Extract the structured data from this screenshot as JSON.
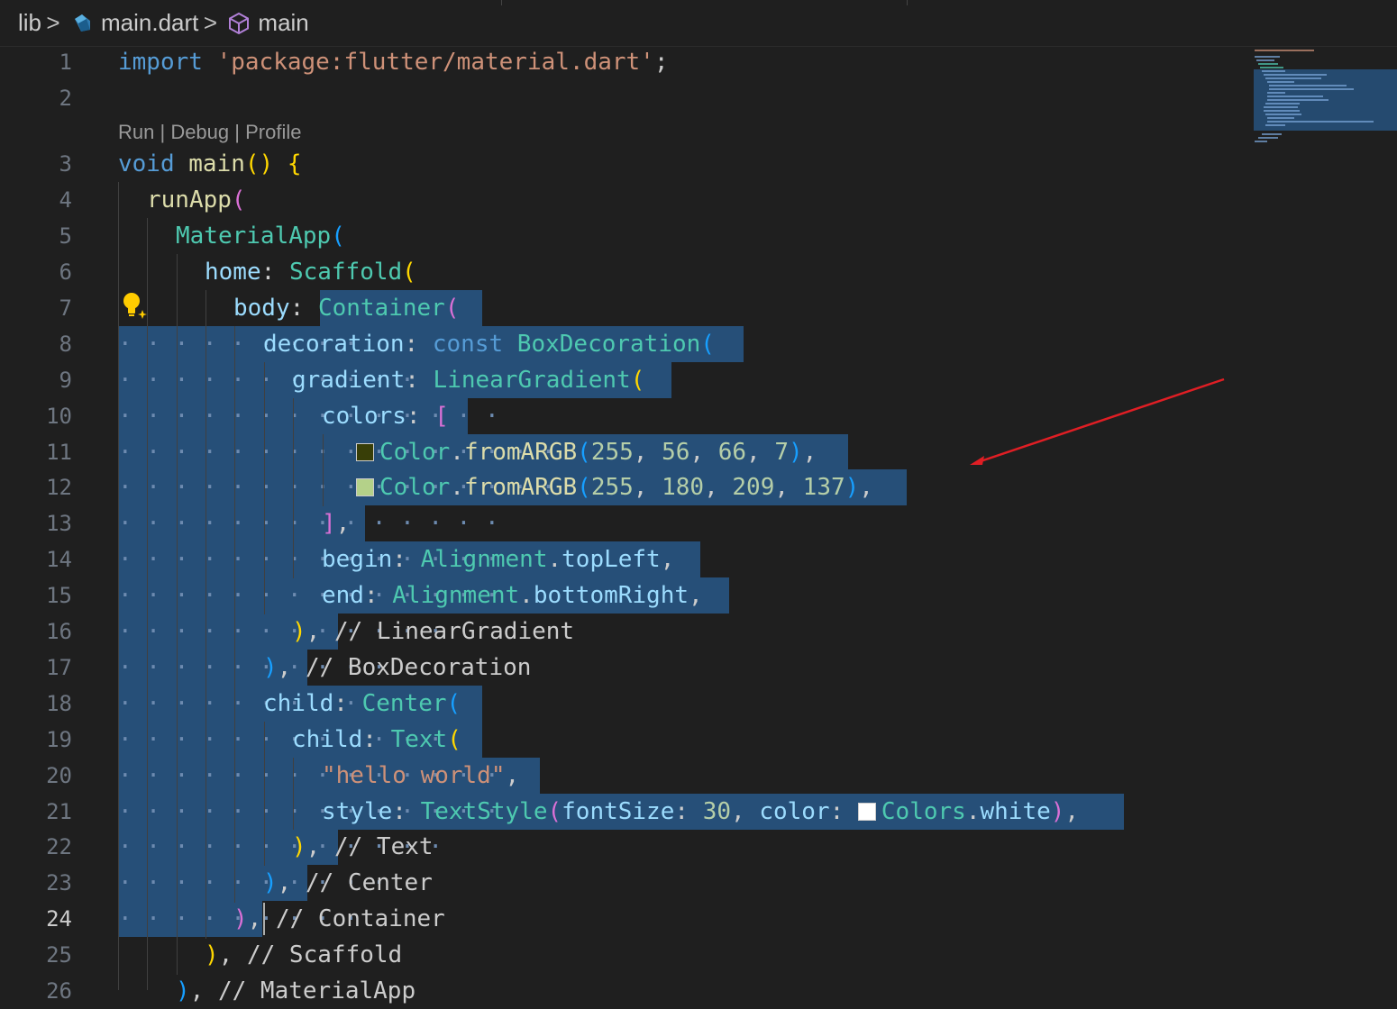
{
  "breadcrumb": {
    "folder": "lib",
    "file": "main.dart",
    "symbol": "main",
    "file_icon": "dart-icon",
    "symbol_icon": "cube-icon",
    "separator": ">"
  },
  "codelens": {
    "run": "Run",
    "sep1": " | ",
    "debug": "Debug",
    "sep2": " | ",
    "profile": "Profile"
  },
  "active_line": 24,
  "line_numbers": [
    "1",
    "2",
    "3",
    "4",
    "5",
    "6",
    "7",
    "8",
    "9",
    "10",
    "11",
    "12",
    "13",
    "14",
    "15",
    "16",
    "17",
    "18",
    "19",
    "20",
    "21",
    "22",
    "23",
    "24",
    "25",
    "26"
  ],
  "code": {
    "l1": {
      "kw": "import",
      "str": "'package:flutter/material.dart'",
      "semi": ";"
    },
    "l3": {
      "kw": "void",
      "fn": "main",
      "open": "()",
      "brace": "{"
    },
    "l4": {
      "fn": "runApp",
      "paren": "("
    },
    "l5": {
      "cls": "MaterialApp",
      "paren": "("
    },
    "l6": {
      "prop": "home",
      "colon": ":",
      "cls": "Scaffold",
      "paren": "("
    },
    "l7": {
      "prop": "body",
      "colon": ":",
      "cls": "Container",
      "paren": "("
    },
    "l8": {
      "prop": "decoration",
      "colon": ":",
      "kw": "const",
      "cls": "BoxDecoration",
      "paren": "("
    },
    "l9": {
      "prop": "gradient",
      "colon": ":",
      "cls": "LinearGradient",
      "paren": "("
    },
    "l10": {
      "prop": "colors",
      "colon": ":",
      "bracket": "["
    },
    "l11": {
      "cls": "Color",
      "dot": ".",
      "fn": "fromARGB",
      "open": "(",
      "a": "255",
      "r": "56",
      "g": "66",
      "b": "7",
      "close": ")",
      "comma": ",",
      "swatch": "#383e07"
    },
    "l12": {
      "cls": "Color",
      "dot": ".",
      "fn": "fromARGB",
      "open": "(",
      "a": "255",
      "r": "180",
      "g": "209",
      "b": "137",
      "close": ")",
      "comma": ",",
      "swatch": "#b4d189"
    },
    "l13": {
      "bracket": "]",
      "comma": ","
    },
    "l14": {
      "prop": "begin",
      "colon": ":",
      "cls": "Alignment",
      "dot": ".",
      "prop2": "topLeft",
      "comma": ","
    },
    "l15": {
      "prop": "end",
      "colon": ":",
      "cls": "Alignment",
      "dot": ".",
      "prop2": "bottomRight",
      "comma": ","
    },
    "l16": {
      "paren": ")",
      "comma": ",",
      "cmt": "// LinearGradient"
    },
    "l17": {
      "paren": ")",
      "comma": ",",
      "cmt": "// BoxDecoration"
    },
    "l18": {
      "prop": "child",
      "colon": ":",
      "cls": "Center",
      "paren": "("
    },
    "l19": {
      "prop": "child",
      "colon": ":",
      "cls": "Text",
      "paren": "("
    },
    "l20": {
      "str": "\"hello world\"",
      "comma": ","
    },
    "l21": {
      "prop": "style",
      "colon": ":",
      "cls": "TextStyle",
      "open": "(",
      "prop2": "fontSize",
      "colon2": ":",
      "num": "30",
      "comma1": ",",
      "prop3": "color",
      "colon3": ":",
      "cls2": "Colors",
      "dot": ".",
      "prop4": "white",
      "close": ")",
      "comma": ",",
      "swatch": "#ffffff"
    },
    "l22": {
      "paren": ")",
      "comma": ",",
      "cmt": "// Text"
    },
    "l23": {
      "paren": ")",
      "comma": ",",
      "cmt": "// Center"
    },
    "l24": {
      "paren": ")",
      "comma": ",",
      "cmt": "// Container"
    },
    "l25": {
      "paren": ")",
      "comma": ",",
      "cmt": "// Scaffold"
    },
    "l26": {
      "paren": ")",
      "comma": ",",
      "cmt": "// MaterialApp"
    }
  },
  "colors": {
    "background": "#1f1f1f",
    "selection": "#264f78",
    "annotation_arrow": "#e01e24"
  }
}
